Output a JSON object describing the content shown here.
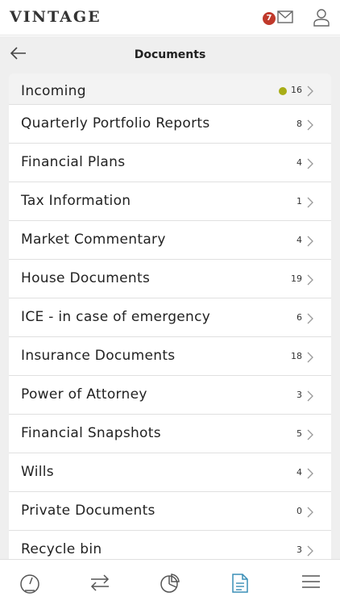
{
  "app": {
    "brand": "VINTAGE",
    "notification_count": "7"
  },
  "header": {
    "title": "Documents"
  },
  "colors": {
    "accent": "#3a8fb7",
    "badge": "#c0392b",
    "dot": "#a8ad16"
  },
  "list": {
    "items": [
      {
        "label": "Incoming",
        "count": "16",
        "has_dot": true
      },
      {
        "label": "Quarterly Portfolio Reports",
        "count": "8"
      },
      {
        "label": "Financial Plans",
        "count": "4"
      },
      {
        "label": "Tax Information",
        "count": "1"
      },
      {
        "label": "Market Commentary",
        "count": "4"
      },
      {
        "label": "House Documents",
        "count": "19"
      },
      {
        "label": "ICE - in case of emergency",
        "count": "6"
      },
      {
        "label": "Insurance Documents",
        "count": "18"
      },
      {
        "label": "Power of Attorney",
        "count": "3"
      },
      {
        "label": "Financial Snapshots",
        "count": "5"
      },
      {
        "label": "Wills",
        "count": "4"
      },
      {
        "label": "Private Documents",
        "count": "0"
      },
      {
        "label": "Recycle bin",
        "count": "3"
      }
    ]
  },
  "bottom_nav": {
    "items": [
      {
        "icon": "dashboard-gauge-icon",
        "active": false
      },
      {
        "icon": "transfer-arrows-icon",
        "active": false
      },
      {
        "icon": "pie-chart-icon",
        "active": false
      },
      {
        "icon": "document-icon",
        "active": true
      },
      {
        "icon": "hamburger-menu-icon",
        "active": false
      }
    ]
  }
}
